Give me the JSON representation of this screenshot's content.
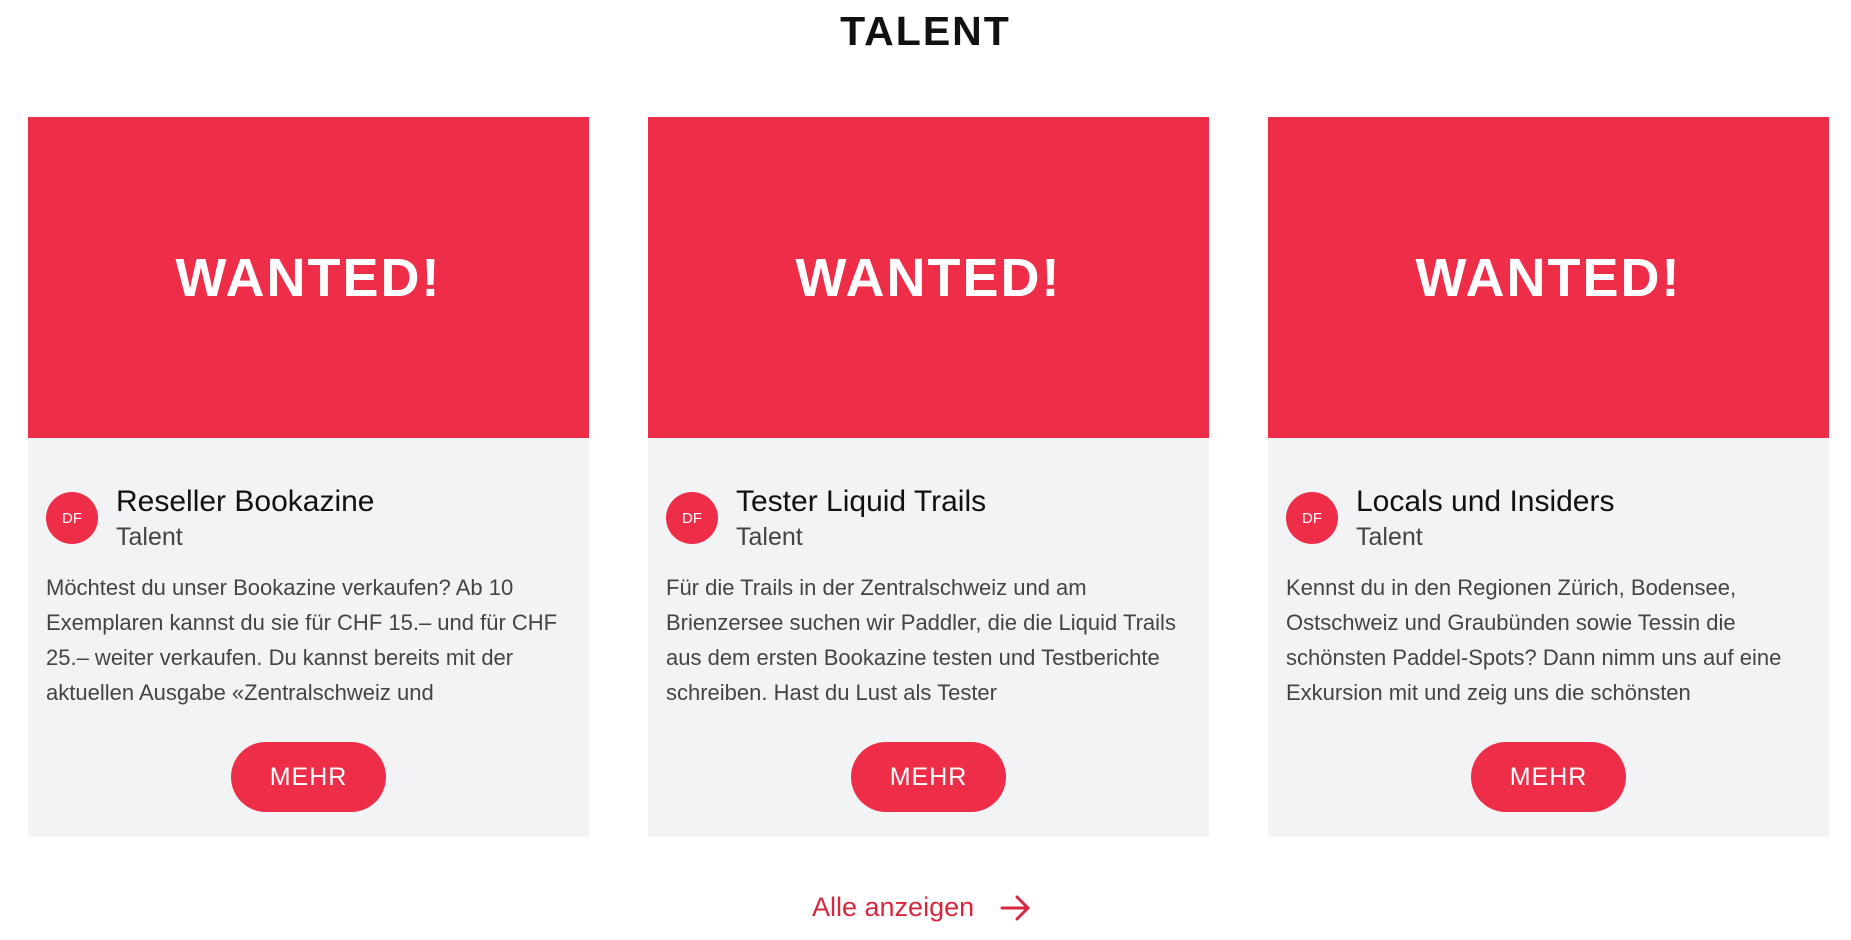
{
  "section": {
    "title": "TALENT"
  },
  "cards": [
    {
      "banner": "WANTED!",
      "avatar": "DF",
      "title": "Reseller Bookazine",
      "category": "Talent",
      "excerpt": "Möchtest du unser Bookazine verkaufen? Ab 10 Exemplaren kannst du sie für CHF 15.– und für CHF 25.– weiter verkaufen. Du kannst bereits mit der aktuellen Ausgabe «Zentralschweiz und",
      "button": "MEHR"
    },
    {
      "banner": "WANTED!",
      "avatar": "DF",
      "title": "Tester Liquid Trails",
      "category": "Talent",
      "excerpt": "Für die Trails in der Zentralschweiz und am Brienzersee suchen wir Paddler, die die Liquid Trails aus dem ersten Bookazine testen und Testberichte schreiben. Hast du Lust als Tester",
      "button": "MEHR"
    },
    {
      "banner": "WANTED!",
      "avatar": "DF",
      "title": "Locals und Insiders",
      "category": "Talent",
      "excerpt": "Kennst du in den Regionen Zürich, Bodensee, Ostschweiz und Graubünden sowie Tessin die schönsten Paddel-Spots? Dann nimm uns auf eine Exkursion mit und zeig uns die schönsten",
      "button": "MEHR"
    }
  ],
  "footer": {
    "show_all": "Alle anzeigen",
    "arrow_icon": "arrow-right-icon"
  },
  "colors": {
    "accent": "#ee2d48",
    "card_bg": "#f2f3f4",
    "link": "#d9263f"
  }
}
